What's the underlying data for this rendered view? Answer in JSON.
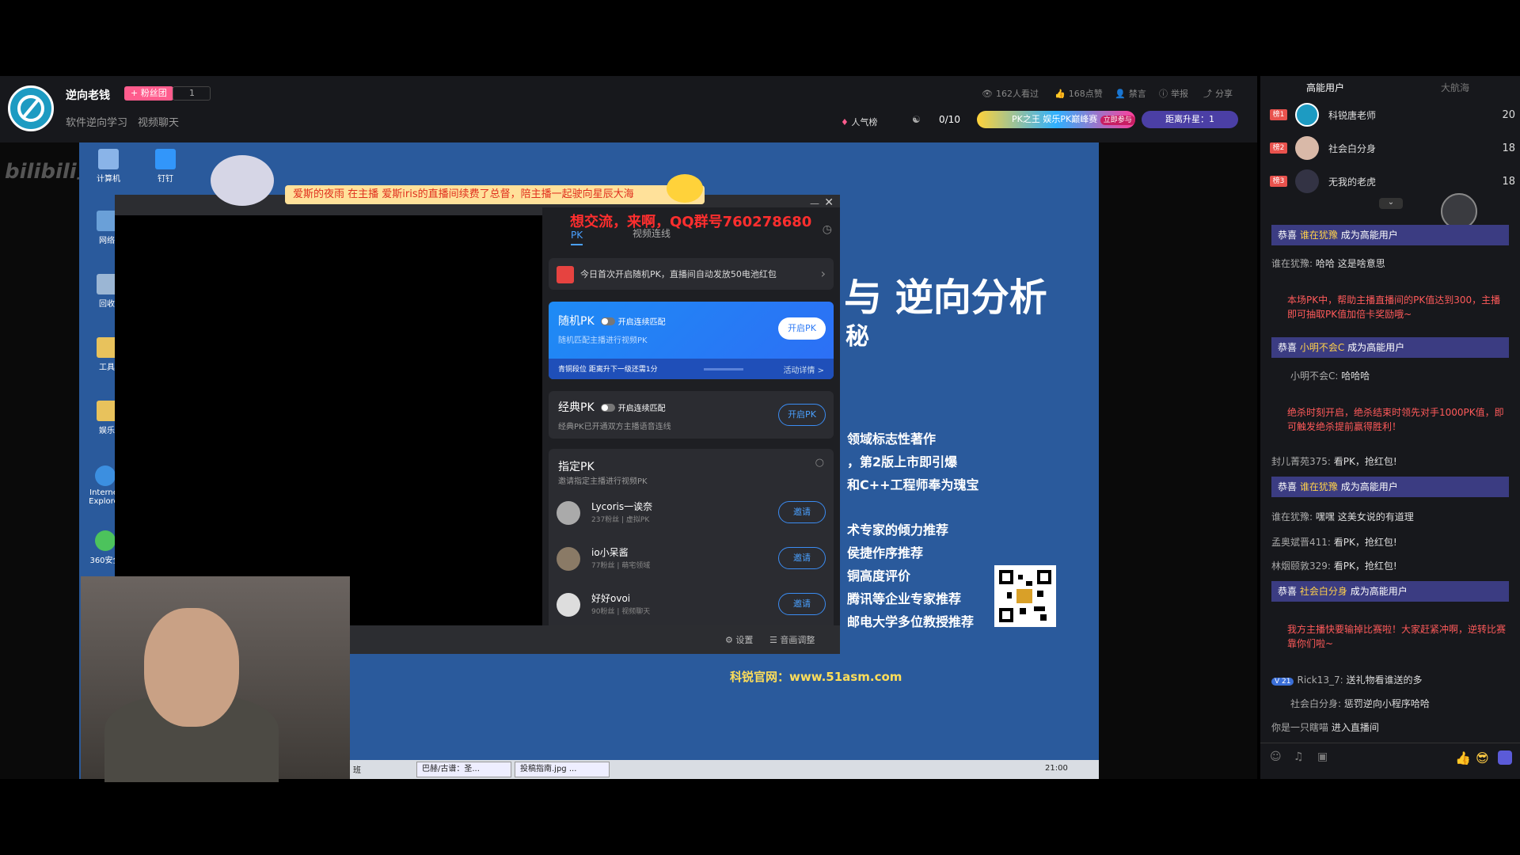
{
  "streamer": {
    "name": "逆向老钱",
    "fan_badge": "+ 粉丝团",
    "fan_count": "1",
    "tags": [
      "软件逆向学习",
      "视频聊天"
    ],
    "viewers": "162人看过",
    "likes": "168点赞",
    "mute_label": "禁言",
    "report_label": "举报",
    "share_label": "分享",
    "popularity_label": "人气榜",
    "pk_progress": "0/10",
    "pk_banner": "PK之王 娱乐PK巅峰赛",
    "pk_banner_tag": "立即参与",
    "level_label": "距离升星：1"
  },
  "stream": {
    "platform_logo": "bilibili直播",
    "desktop_icons": [
      "计算机",
      "钉钉",
      "网络",
      "回收",
      "工具",
      "娱乐",
      "Internet Explorer",
      "360安全"
    ],
    "ticker": "爱斯的夜雨 在主播 爱斯iris的直播间续费了总督，陪主播一起驶向星辰大海",
    "qq_group": "想交流，来啊，QQ群号760278680",
    "slide_title": "与 逆向分析",
    "slide_lines": [
      "领域标志性著作",
      "，第2版上市即引爆",
      "和C++工程师奉为瑰宝",
      "术专家的倾力推荐",
      "侯捷作序推荐",
      "铜高度评价",
      "腾讯等企业专家推荐",
      "邮电大学多位教授推荐"
    ],
    "website": "科锐官网：www.51asm.com",
    "taskbar_items": [
      "班",
      "巴赫/古谱：圣...",
      "投稿指南.jpg ..."
    ],
    "clock": "21:00"
  },
  "pk_panel": {
    "tabs": [
      "PK",
      "视频连线"
    ],
    "notice": "今日首次开启随机PK，直播间自动发放50电池红包",
    "random": {
      "title": "随机PK",
      "toggle_label": "开启连续匹配",
      "desc": "随机匹配主播进行视频PK",
      "button": "开启PK",
      "progress_text": "青铜段位 距离升下一级还需1分",
      "detail": "活动详情 >"
    },
    "classic": {
      "title": "经典PK",
      "toggle_label": "开启连续匹配",
      "desc": "经典PK已开通双方主播语音连线",
      "button": "开启PK"
    },
    "designated": {
      "title": "指定PK",
      "desc": "邀请指定主播进行视频PK"
    },
    "users": [
      {
        "name": "Lycoris一诶奈",
        "sub": "237粉丝 | 虚拟PK",
        "button": "邀请"
      },
      {
        "name": "io小呆酱",
        "sub": "77粉丝 | 萌宅领域",
        "button": "邀请"
      },
      {
        "name": "好好ovoi",
        "sub": "90粉丝 | 视频聊天",
        "button": "邀请"
      }
    ],
    "settings": "设置",
    "audio": "音画调整"
  },
  "right_panel": {
    "tabs": [
      "高能用户",
      "大航海"
    ],
    "ranking": [
      {
        "rank": "榜1",
        "name": "科锐唐老师",
        "value": "20"
      },
      {
        "rank": "榜2",
        "name": "社会白分身",
        "value": "18"
      },
      {
        "rank": "榜3",
        "name": "无我的老虎",
        "value": "18"
      }
    ],
    "chat": [
      {
        "type": "sys",
        "prefix": "恭喜",
        "user": "谁在犹豫",
        "suffix": "成为高能用户"
      },
      {
        "type": "msg",
        "user": "谁在犹豫",
        "text": "哈哈 这是啥意思"
      },
      {
        "type": "red",
        "text": "本场PK中，帮助主播直播间的PK值达到300，主播即可抽取PK值加倍卡奖励哦~"
      },
      {
        "type": "sys",
        "prefix": "恭喜",
        "user": "小明不会C",
        "suffix": "成为高能用户"
      },
      {
        "type": "msg",
        "user": "小明不会C",
        "text": "哈哈哈"
      },
      {
        "type": "red",
        "text": "绝杀时刻开启，绝杀结束时领先对手1000PK值，即可触发绝杀提前赢得胜利！"
      },
      {
        "type": "msg",
        "user": "封儿菁苑375",
        "text": "看PK，抢红包!"
      },
      {
        "type": "sys",
        "prefix": "恭喜",
        "user": "谁在犹豫",
        "suffix": "成为高能用户"
      },
      {
        "type": "msg",
        "user": "谁在犹豫",
        "text": "嘿嘿 这美女说的有道理"
      },
      {
        "type": "msg",
        "user": "孟奥斌晋411",
        "text": "看PK，抢红包!"
      },
      {
        "type": "msg",
        "user": "林烟颐敦329",
        "text": "看PK，抢红包!"
      },
      {
        "type": "sys",
        "prefix": "恭喜",
        "user": "社会白分身",
        "suffix": "成为高能用户"
      },
      {
        "type": "red",
        "text": "我方主播快要输掉比赛啦！大家赶紧冲啊，逆转比赛靠你们啦~"
      },
      {
        "type": "msg",
        "user": "Rick13_7",
        "text": "送礼物看谁送的多"
      },
      {
        "type": "msg",
        "user": "社会白分身",
        "text": "惩罚逆向小程序哈哈"
      },
      {
        "type": "msg",
        "user": "你是一只瞎喵",
        "text": "进入直播间"
      }
    ]
  }
}
